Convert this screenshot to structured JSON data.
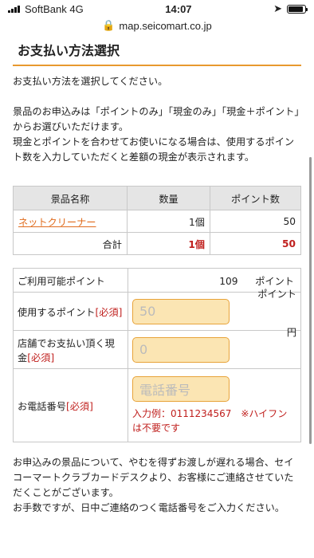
{
  "status_bar": {
    "carrier": "SoftBank 4G",
    "time": "14:07"
  },
  "browser": {
    "url": "map.seicomart.co.jp"
  },
  "page": {
    "heading": "お支払い方法選択",
    "intro": "お支払い方法を選択してください。",
    "desc1": "景品のお申込みは「ポイントのみ」「現金のみ」「現金＋ポイント」からお選びいただけます。",
    "desc2": "現金とポイントを合わせてお使いになる場合は、使用するポイント数を入力していただくと差額の現金が表示されます。"
  },
  "items_table": {
    "headers": [
      "景品名称",
      "数量",
      "ポイント数"
    ],
    "rows": [
      {
        "name": "ネットクリーナー",
        "qty": "1個",
        "points": "50"
      }
    ],
    "total_label": "合計",
    "total_qty": "1個",
    "total_points": "50"
  },
  "payment_form": {
    "available_label": "ご利用可能ポイント",
    "available_value": "109",
    "available_unit": "ポイント",
    "use_points_label": "使用するポイント",
    "use_points_placeholder": "50",
    "use_points_unit": "ポイント",
    "cash_label": "店舗でお支払い頂く現金",
    "cash_placeholder": "0",
    "cash_unit": "円",
    "phone_label": "お電話番号",
    "phone_placeholder": "電話番号",
    "phone_example": "入力例：0111234567　※ハイフンは不要です",
    "required": "[必須]"
  },
  "bottom_notice": "お申込みの景品について、やむを得ずお渡しが遅れる場合、セイコーマートクラブカードデスクより、お客様にご連絡させていただくことがございます。",
  "bottom_notice2": "お手数ですが、日中ご連絡のつく電話番号をご入力ください。"
}
